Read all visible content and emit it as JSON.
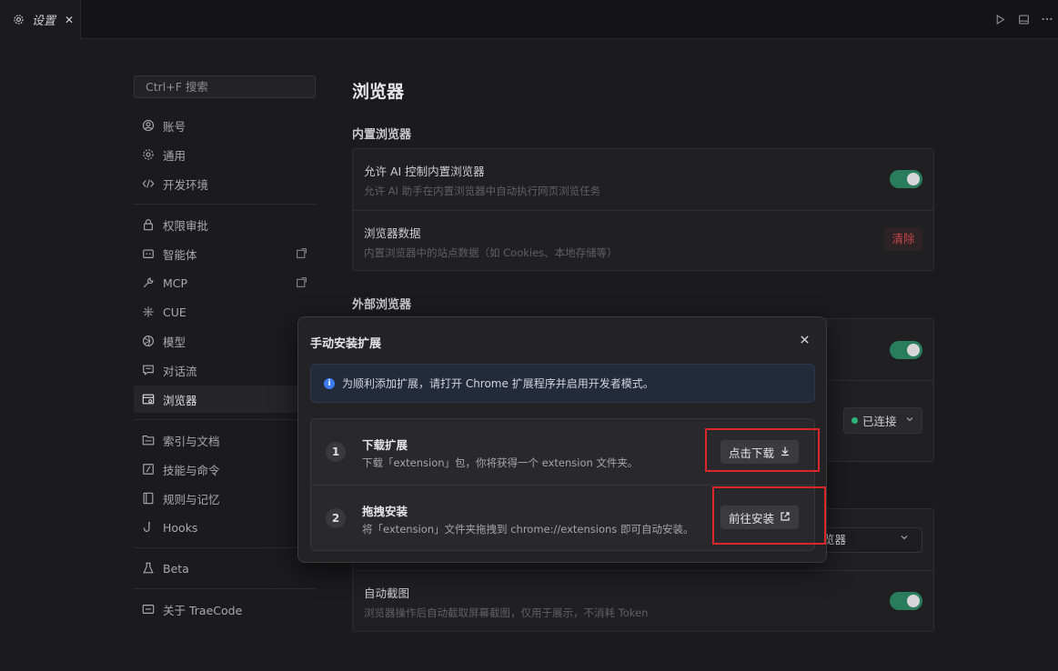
{
  "tab": {
    "label": "设置",
    "close": "✕"
  },
  "sidebar": {
    "search_placeholder": "Ctrl+F 搜索",
    "items": [
      {
        "label": "账号"
      },
      {
        "label": "通用"
      },
      {
        "label": "开发环境"
      },
      {
        "label": "权限审批"
      },
      {
        "label": "智能体"
      },
      {
        "label": "MCP"
      },
      {
        "label": "CUE"
      },
      {
        "label": "模型"
      },
      {
        "label": "对话流"
      },
      {
        "label": "浏览器"
      },
      {
        "label": "索引与文档"
      },
      {
        "label": "技能与命令"
      },
      {
        "label": "规则与记忆"
      },
      {
        "label": "Hooks"
      },
      {
        "label": "Beta"
      },
      {
        "label": "关于 TraeCode"
      }
    ]
  },
  "main": {
    "title": "浏览器",
    "builtin_section": "内置浏览器",
    "allow_ai": {
      "title": "允许 AI 控制内置浏览器",
      "desc": "允许 AI 助手在内置浏览器中自动执行网页浏览任务"
    },
    "browser_data": {
      "title": "浏览器数据",
      "desc": "内置浏览器中的站点数据（如 Cookies、本地存储等）",
      "clear_label": "清除"
    },
    "external_section": "外部浏览器",
    "connection_status": "已连接",
    "select_partial": "览器",
    "screenshot": {
      "title": "自动截图",
      "desc": "浏览器操作后自动截取屏幕截图，仅用于展示，不消耗 Token"
    }
  },
  "modal": {
    "title": "手动安装扩展",
    "info": "为顺利添加扩展，请打开 Chrome 扩展程序并启用开发者模式。",
    "steps": [
      {
        "num": "1",
        "title": "下载扩展",
        "desc": "下载「extension」包，你将获得一个 extension 文件夹。",
        "button": "点击下载"
      },
      {
        "num": "2",
        "title": "拖拽安装",
        "desc": "将「extension」文件夹拖拽到 chrome://extensions 即可自动安装。",
        "button": "前往安装"
      }
    ]
  }
}
